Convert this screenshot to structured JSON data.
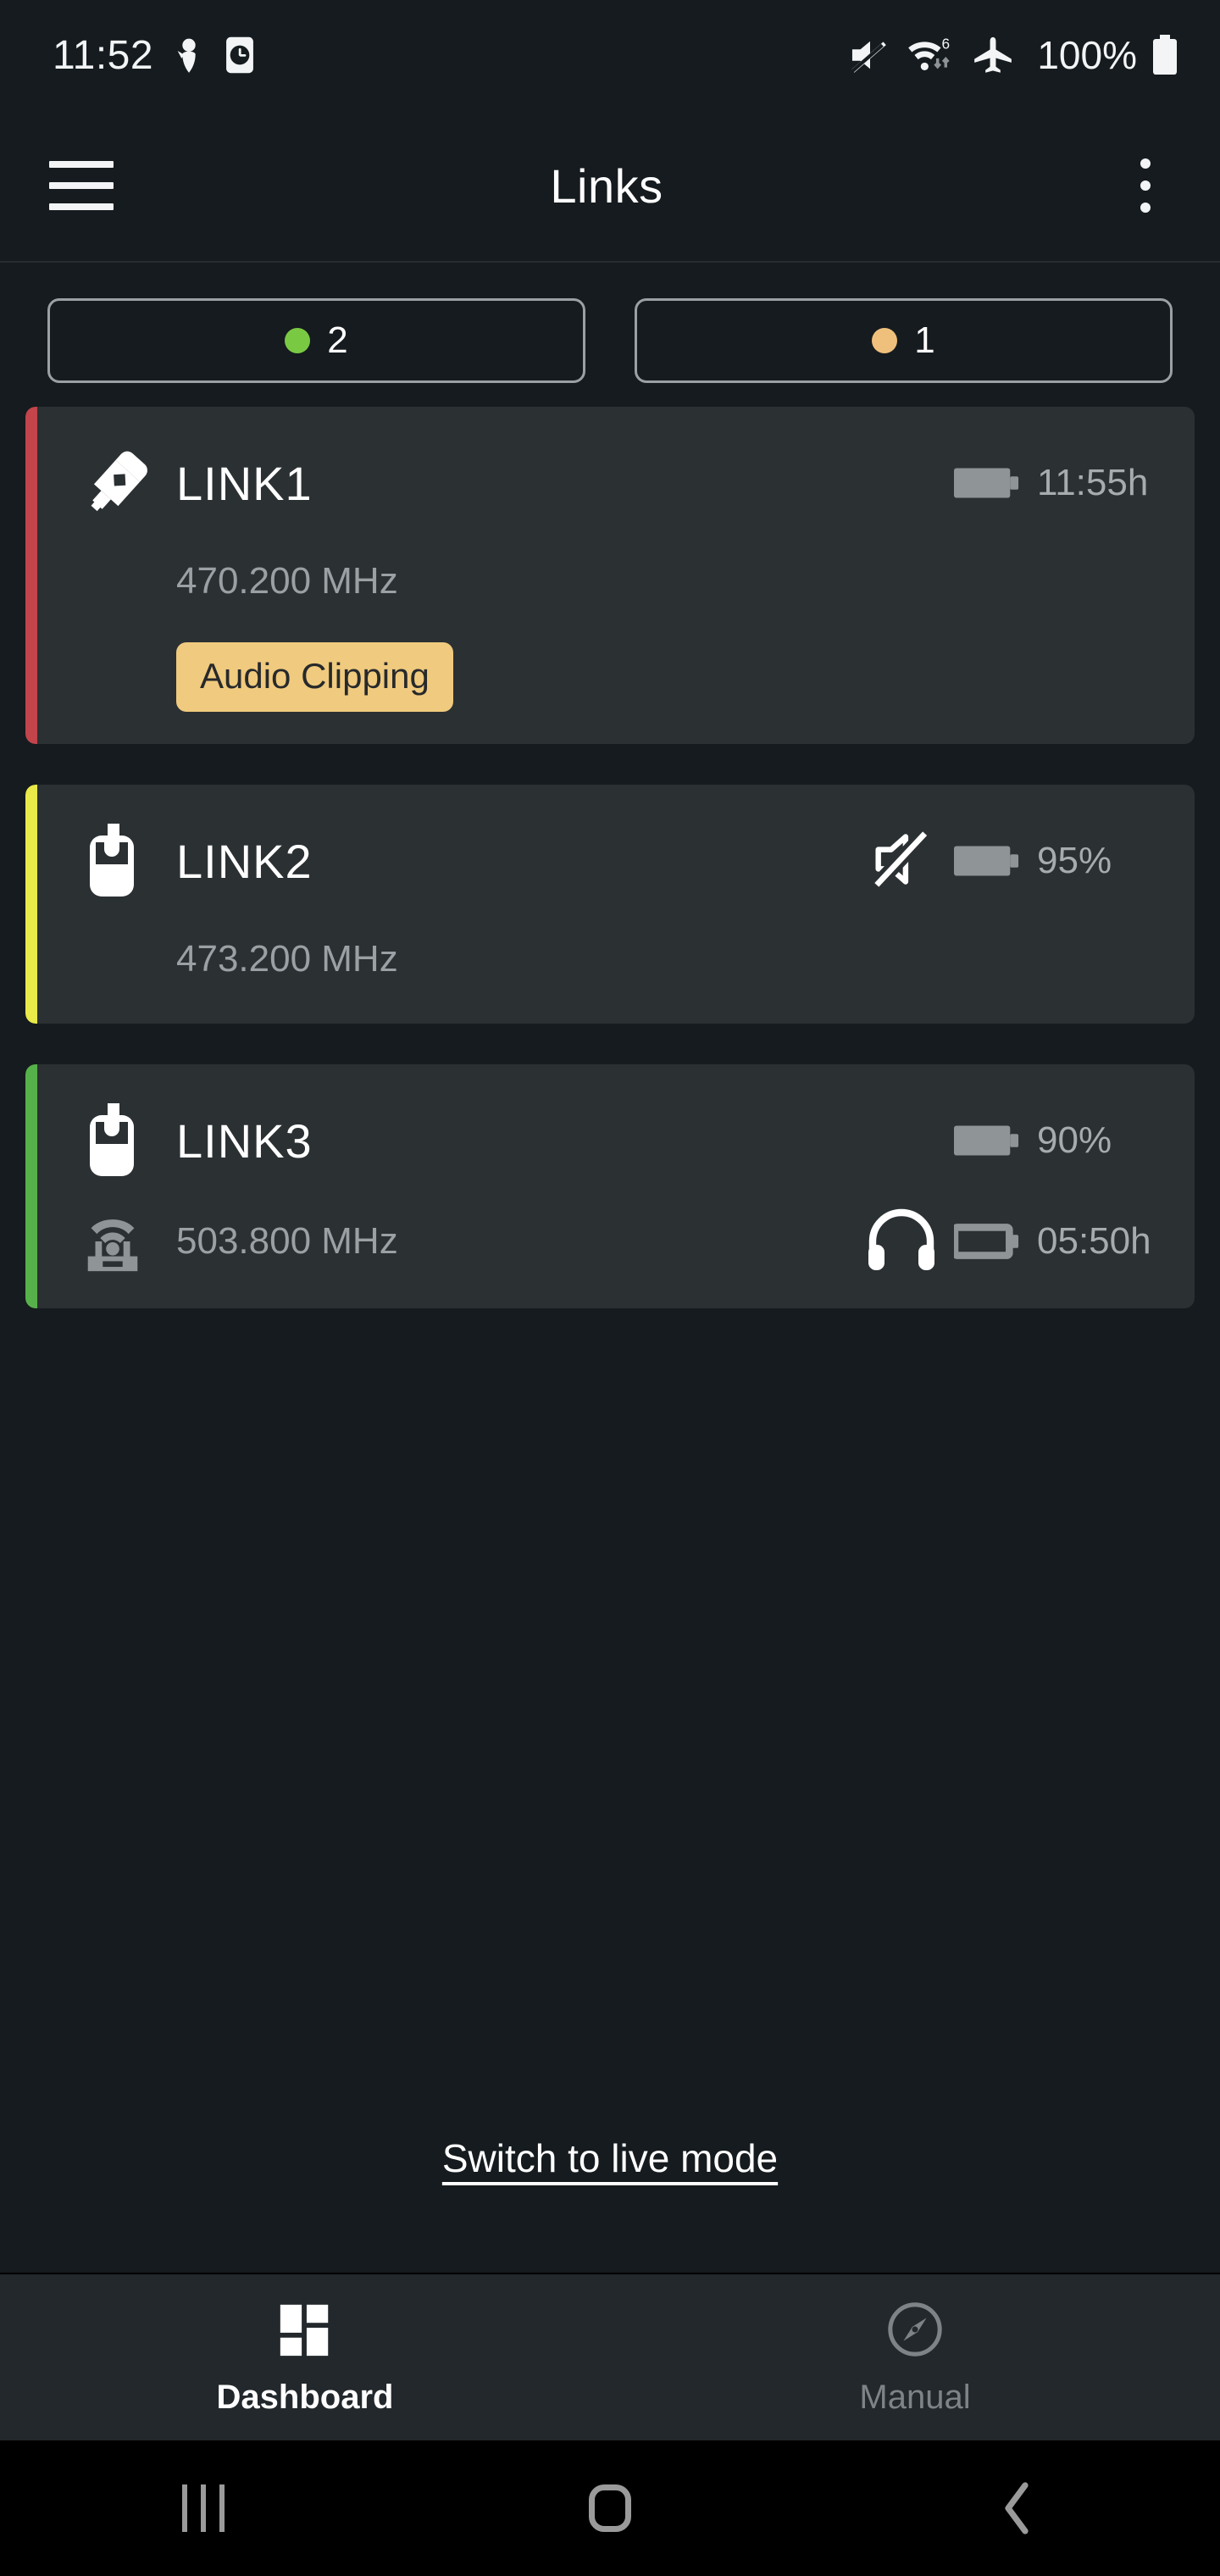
{
  "status_bar": {
    "time": "11:52",
    "icons_left": [
      "bug-icon",
      "alarm-clock-icon"
    ],
    "icons_right": [
      "mute-icon",
      "wifi-6-icon",
      "airplane-mode-icon"
    ],
    "battery_percent": "100%"
  },
  "app_bar": {
    "menu_icon": "hamburger-menu-icon",
    "title": "Links",
    "overflow_icon": "more-vertical-icon"
  },
  "filters": [
    {
      "count": "2",
      "dot_color": "#7ac943",
      "status": "ok"
    },
    {
      "count": "1",
      "dot_color": "#efc07c",
      "status": "warning"
    }
  ],
  "links": [
    {
      "name": "LINK1",
      "accent_color": "#c4444b",
      "device_icon": "handheld-microphone-icon",
      "frequency": "470.200 MHz",
      "battery_icon": "battery-full-icon",
      "battery_value": "11:55h",
      "badge": "Audio Clipping",
      "badge_color": "#f0ca7e",
      "muted": false,
      "second_row": null
    },
    {
      "name": "LINK2",
      "accent_color": "#e9e94a",
      "device_icon": "bodypack-transmitter-icon",
      "frequency": "473.200 MHz",
      "mute_icon": "audio-muted-icon",
      "battery_icon": "battery-full-icon",
      "battery_value": "95%",
      "badge": null,
      "muted": true,
      "second_row": null
    },
    {
      "name": "LINK3",
      "accent_color": "#56b14a",
      "device_icon": "bodypack-transmitter-icon",
      "frequency": "503.800 MHz",
      "battery_icon": "battery-full-icon",
      "battery_value": "90%",
      "badge": null,
      "muted": false,
      "second_row": {
        "receiver_icon": "receiver-antenna-icon",
        "headphone_icon": "headphones-icon",
        "battery_icon": "battery-empty-icon",
        "battery_value": "05:50h"
      }
    }
  ],
  "live_mode_link": "Switch to live mode",
  "tabs": [
    {
      "label": "Dashboard",
      "icon": "dashboard-grid-icon",
      "active": true
    },
    {
      "label": "Manual",
      "icon": "compass-icon",
      "active": false
    }
  ],
  "android_nav": {
    "recents": "recents-icon",
    "home": "home-icon",
    "back": "back-icon"
  },
  "colors": {
    "page_background": "#151b1e",
    "card_background": "#2b3033",
    "tabbar_background": "#22282b",
    "text_primary": "#ffffff",
    "text_secondary": "#9aa0a4"
  }
}
